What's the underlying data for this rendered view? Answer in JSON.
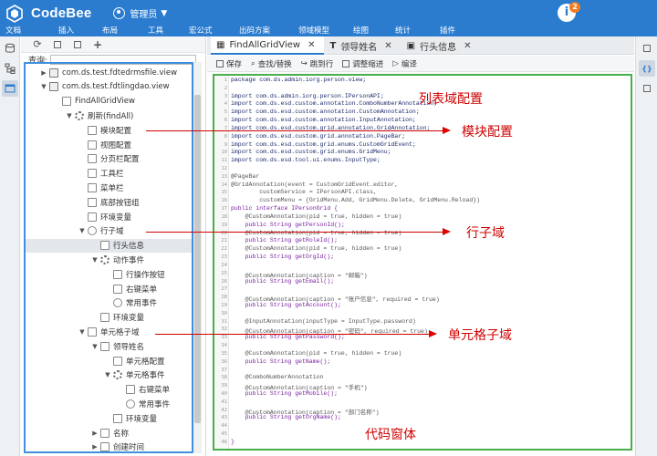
{
  "app": {
    "brand": "CodeBee",
    "role": "管理员",
    "notification_count": "2",
    "help_glyph": "i"
  },
  "menu": [
    "文档",
    "插入",
    "布局",
    "工具",
    "宏公式",
    "出码方案",
    "领域模型",
    "绘图",
    "统计",
    "插件"
  ],
  "tree": {
    "search_label": "查询:",
    "search_value": "",
    "rows": [
      {
        "label": "com.ds.test.fdtedrmsfile.view",
        "indent": 0,
        "caret": "▶",
        "icon": "folder"
      },
      {
        "label": "com.ds.test.fdtlingdao.view",
        "indent": 0,
        "caret": "▼",
        "icon": "folder"
      },
      {
        "label": "FindAllGridView",
        "indent": 1,
        "caret": "",
        "icon": "grid"
      },
      {
        "label": "刷新(findAll)",
        "indent": 2,
        "caret": "▼",
        "icon": "gear"
      },
      {
        "label": "模块配置",
        "indent": 3,
        "caret": "",
        "icon": "doc"
      },
      {
        "label": "视图配置",
        "indent": 3,
        "caret": "",
        "icon": "doc"
      },
      {
        "label": "分页栏配置",
        "indent": 3,
        "caret": "",
        "icon": "doc"
      },
      {
        "label": "工具栏",
        "indent": 3,
        "caret": "",
        "icon": "doc"
      },
      {
        "label": "菜单栏",
        "indent": 3,
        "caret": "",
        "icon": "doc"
      },
      {
        "label": "底部按钮组",
        "indent": 3,
        "caret": "",
        "icon": "doc"
      },
      {
        "label": "环境变量",
        "indent": 3,
        "caret": "",
        "icon": "doc"
      },
      {
        "label": "行子域",
        "indent": 3,
        "caret": "▼",
        "icon": "circle"
      },
      {
        "label": "行头信息",
        "indent": 4,
        "caret": "",
        "icon": "doc",
        "selected": true
      },
      {
        "label": "动作事件",
        "indent": 4,
        "caret": "▼",
        "icon": "gear"
      },
      {
        "label": "行操作按钮",
        "indent": 5,
        "caret": "",
        "icon": "doc"
      },
      {
        "label": "右键菜单",
        "indent": 5,
        "caret": "",
        "icon": "doc"
      },
      {
        "label": "常用事件",
        "indent": 5,
        "caret": "",
        "icon": "circle"
      },
      {
        "label": "环境变量",
        "indent": 4,
        "caret": "",
        "icon": "doc"
      },
      {
        "label": "单元格子域",
        "indent": 3,
        "caret": "▼",
        "icon": "doc"
      },
      {
        "label": "领导姓名",
        "indent": 4,
        "caret": "▼",
        "icon": "doc"
      },
      {
        "label": "单元格配置",
        "indent": 5,
        "caret": "",
        "icon": "doc"
      },
      {
        "label": "单元格事件",
        "indent": 5,
        "caret": "▼",
        "icon": "gear"
      },
      {
        "label": "右键菜单",
        "indent": 6,
        "caret": "",
        "icon": "doc"
      },
      {
        "label": "常用事件",
        "indent": 6,
        "caret": "",
        "icon": "circle"
      },
      {
        "label": "环境变量",
        "indent": 5,
        "caret": "",
        "icon": "doc"
      },
      {
        "label": "名称",
        "indent": 4,
        "caret": "▶",
        "icon": "doc"
      },
      {
        "label": "创建时间",
        "indent": 4,
        "caret": "▶",
        "icon": "doc"
      }
    ]
  },
  "tabs": [
    {
      "label": "FindAllGridView",
      "active": true
    },
    {
      "label": "领导姓名",
      "active": false
    },
    {
      "label": "行头信息",
      "active": false
    }
  ],
  "editor_toolbar": [
    "保存",
    "查找/替换",
    "跳到行",
    "调整缩进",
    "编译"
  ],
  "code_lines": [
    {
      "n": "1",
      "text": "package com.ds.admin.iorg.person.view;",
      "cls": ""
    },
    {
      "n": "2",
      "text": "",
      "cls": ""
    },
    {
      "n": "3",
      "text": "import com.ds.admin.iorg.person.IPersonAPI;",
      "cls": ""
    },
    {
      "n": "4",
      "text": "import com.ds.esd.custom.annotation.ComboNumberAnnotation;",
      "cls": ""
    },
    {
      "n": "5",
      "text": "import com.ds.esd.custom.annotation.CustomAnnotation;",
      "cls": ""
    },
    {
      "n": "6",
      "text": "import com.ds.esd.custom.annotation.InputAnnotation;",
      "cls": ""
    },
    {
      "n": "7",
      "text": "import com.ds.esd.custom.grid.annotation.GridAnnotation;",
      "cls": ""
    },
    {
      "n": "8",
      "text": "import com.ds.esd.custom.grid.annotation.PageBar;",
      "cls": ""
    },
    {
      "n": "9",
      "text": "import com.ds.esd.custom.grid.enums.CustomGridEvent;",
      "cls": ""
    },
    {
      "n": "10",
      "text": "import com.ds.esd.custom.grid.enums.GridMenu;",
      "cls": ""
    },
    {
      "n": "11",
      "text": "import com.ds.esd.tool.ui.enums.InputType;",
      "cls": ""
    },
    {
      "n": "12",
      "text": "",
      "cls": ""
    },
    {
      "n": "13",
      "text": "@PageBar",
      "cls": "an"
    },
    {
      "n": "14",
      "text": "@GridAnnotation(event = CustomGridEvent.editor,",
      "cls": "an"
    },
    {
      "n": "15",
      "text": "        customService = IPersonAPI.class,",
      "cls": "an"
    },
    {
      "n": "16",
      "text": "        customMenu = {GridMenu.Add, GridMenu.Delete, GridMenu.Reload})",
      "cls": "an"
    },
    {
      "n": "17",
      "text": "public interface IPersonGrid {",
      "cls": "kw"
    },
    {
      "n": "18",
      "text": "    @CustomAnnotation(pid = true, hidden = true)",
      "cls": "an"
    },
    {
      "n": "19",
      "text": "    public String getPersonId();",
      "cls": "kw"
    },
    {
      "n": "20",
      "text": "    @CustomAnnotation(pid = true, hidden = true)",
      "cls": "an"
    },
    {
      "n": "21",
      "text": "    public String getRoleId();",
      "cls": "kw"
    },
    {
      "n": "22",
      "text": "    @CustomAnnotation(pid = true, hidden = true)",
      "cls": "an"
    },
    {
      "n": "23",
      "text": "    public String getOrgId();",
      "cls": "kw"
    },
    {
      "n": "24",
      "text": "",
      "cls": ""
    },
    {
      "n": "25",
      "text": "    @CustomAnnotation(caption = \"邮箱\")",
      "cls": "an"
    },
    {
      "n": "26",
      "text": "    public String getEmail();",
      "cls": "kw"
    },
    {
      "n": "27",
      "text": "",
      "cls": ""
    },
    {
      "n": "28",
      "text": "    @CustomAnnotation(caption = \"账户信息\", required = true)",
      "cls": "an"
    },
    {
      "n": "29",
      "text": "    public String getAccount();",
      "cls": "kw"
    },
    {
      "n": "30",
      "text": "",
      "cls": ""
    },
    {
      "n": "31",
      "text": "    @InputAnnotation(inputType = InputType.password)",
      "cls": "an"
    },
    {
      "n": "32",
      "text": "    @CustomAnnotation(caption = \"密码\", required = true)",
      "cls": "an"
    },
    {
      "n": "33",
      "text": "    public String getPassword();",
      "cls": "kw"
    },
    {
      "n": "34",
      "text": "",
      "cls": ""
    },
    {
      "n": "35",
      "text": "    @CustomAnnotation(pid = true, hidden = true)",
      "cls": "an"
    },
    {
      "n": "36",
      "text": "    public String getName();",
      "cls": "kw"
    },
    {
      "n": "37",
      "text": "",
      "cls": ""
    },
    {
      "n": "38",
      "text": "    @ComboNumberAnnotation",
      "cls": "an"
    },
    {
      "n": "39",
      "text": "    @CustomAnnotation(caption = \"手机\")",
      "cls": "an"
    },
    {
      "n": "40",
      "text": "    public String getMobile();",
      "cls": "kw"
    },
    {
      "n": "41",
      "text": "",
      "cls": ""
    },
    {
      "n": "42",
      "text": "    @CustomAnnotation(caption = \"部门名称\")",
      "cls": "an"
    },
    {
      "n": "43",
      "text": "    public String getOrgName();",
      "cls": "kw"
    },
    {
      "n": "44",
      "text": "",
      "cls": ""
    },
    {
      "n": "45",
      "text": "",
      "cls": ""
    },
    {
      "n": "46",
      "text": "}",
      "cls": "kw"
    }
  ],
  "annotations": {
    "list_config": "列表域配置",
    "module_config": "模块配置",
    "row_domain": "行子域",
    "cell_domain": "单元格子域",
    "code_window": "代码窗体"
  },
  "colors": {
    "topbar": "#2b7ccf",
    "tree_border": "#3d8fe0",
    "code_border": "#48b04a",
    "annotation_red": "#d00000",
    "badge_orange": "#f47c20"
  }
}
